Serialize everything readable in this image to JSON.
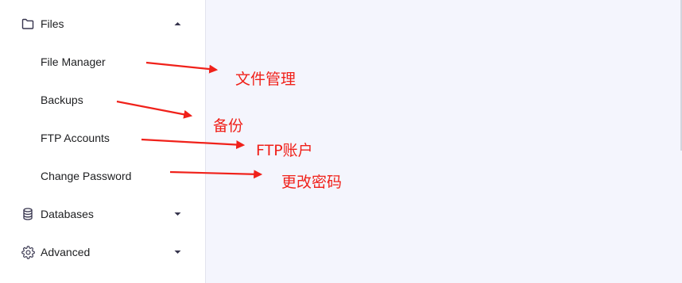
{
  "sidebar": {
    "files": {
      "label": "Files",
      "icon": "folder-icon",
      "expanded": true
    },
    "sub_items": [
      {
        "label": "File Manager"
      },
      {
        "label": "Backups"
      },
      {
        "label": "FTP Accounts"
      },
      {
        "label": "Change Password"
      }
    ],
    "databases": {
      "label": "Databases",
      "icon": "database-icon"
    },
    "advanced": {
      "label": "Advanced",
      "icon": "gear-icon"
    }
  },
  "annotations": [
    {
      "text": "文件管理",
      "color": "#f0211a"
    },
    {
      "text": "备份",
      "color": "#f0211a"
    },
    {
      "text": "FTP账户",
      "color": "#f0211a"
    },
    {
      "text": "更改密码",
      "color": "#f0211a"
    }
  ]
}
